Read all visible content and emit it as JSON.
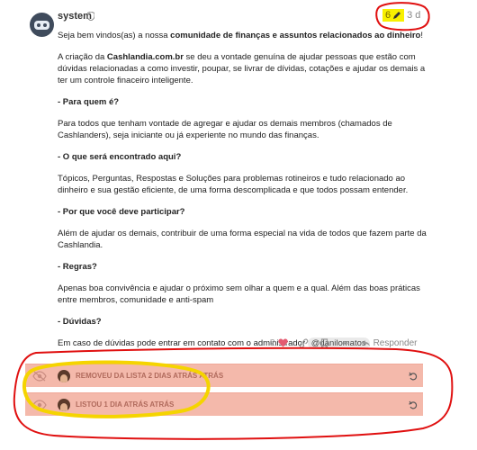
{
  "post": {
    "username": "system",
    "edit_count": "6",
    "date": "3 d",
    "paragraphs": {
      "p1_pre": "Seja bem vindos(as) a nossa ",
      "p1_bold": "comunidade de finanças e assuntos relacionados ao dinheiro",
      "p1_post": "!",
      "p2_pre": "A criação da ",
      "p2_bold": "Cashlandia.com.br",
      "p2_post": " se deu a vontade genuína de ajudar pessoas que estão com dúvidas relacionadas a como investir, poupar, se livrar de dívidas, cotações e ajudar os demais a ter um controle finaceiro inteligente.",
      "h1": "- Para quem é?",
      "p3": "Para todos que tenham vontade de agregar e ajudar os demais membros (chamados de Cashlanders), seja iniciante ou já experiente no mundo das finanças.",
      "h2": "- O que será encontrado aqui?",
      "p4": "Tópicos, Perguntas, Respostas e Soluções para problemas rotineiros e tudo relacionado ao dinheiro e sua gestão eficiente, de uma forma descomplicada e que todos possam entender.",
      "h3": "- Por que você deve participar?",
      "p5": "Além de ajudar os demais, contribuir de uma forma especial na vida de todos que fazem parte da Cashlandia.",
      "h4": "- Regras?",
      "p6": "Apenas boa convivência e ajudar o próximo sem olhar a quem e a qual. Além das boas práticas entre membros, comunidade e anti-spam",
      "h5": "- Dúvidas?",
      "p7": "Em caso de dúvidas pode entrar em contato com o administrador ",
      "mention": "@danilomatos"
    },
    "actions": {
      "like_count": "2",
      "reply_label": "Responder"
    }
  },
  "small_actions": [
    {
      "text": "REMOVEU DA LISTA 2 DIAS ATRÁS ATRÁS",
      "icon": "eye-slash-icon"
    },
    {
      "text": "LISTOU 1 DIA ATRÁS ATRÁS",
      "icon": "eye-icon"
    }
  ],
  "colors": {
    "highlight": "#f8f000",
    "annotation_red": "#e01010",
    "annotation_yellow": "#f5d400",
    "small_action_bg": "#f4b9ab"
  }
}
